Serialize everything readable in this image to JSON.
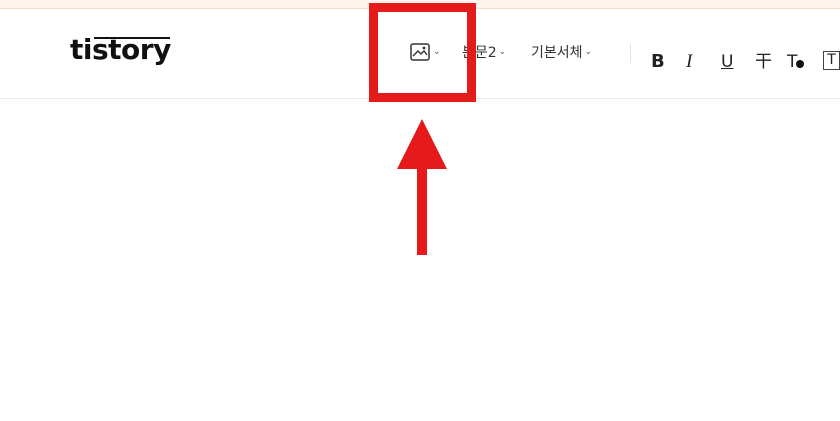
{
  "top_strip": {
    "color": "#fff5ee"
  },
  "logo": {
    "text": "tistory"
  },
  "toolbar": {
    "image_button": {
      "icon": "image-icon",
      "chevron": "⌄"
    },
    "paragraph_style": {
      "label": "본문2",
      "chevron": "⌄"
    },
    "font_family": {
      "label": "기본서체",
      "chevron": "⌄"
    },
    "bold": "B",
    "italic": "I",
    "underline": "U",
    "strikethrough": "干",
    "text_color": "T",
    "background_color": "T"
  },
  "annotation": {
    "color": "#e51b1b",
    "box_target": "image-button",
    "arrow_direction": "up"
  }
}
